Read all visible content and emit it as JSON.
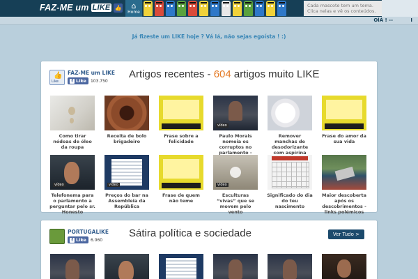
{
  "header": {
    "logo_text": "FAZ-ME um",
    "logo_like": "LIKE",
    "home_label": "Home",
    "tip_text": "Cada mascote tem um tema. Clica nelas e vê os conteúdos.",
    "greeting": "OlÁ ! -- ",
    "greeting_close": "I"
  },
  "mascots": [
    {
      "name": "mascot-1",
      "color": "#f0d23a"
    },
    {
      "name": "mascot-2",
      "color": "#d94b3a"
    },
    {
      "name": "mascot-3",
      "color": "#2e78c8"
    },
    {
      "name": "mascot-4",
      "color": "#5aa13d"
    },
    {
      "name": "mascot-5",
      "color": "#d94b3a"
    },
    {
      "name": "mascot-6",
      "color": "#f0d23a"
    },
    {
      "name": "mascot-7",
      "color": "#2e78c8"
    },
    {
      "name": "mascot-8",
      "color": "#e8e8e8"
    },
    {
      "name": "mascot-9",
      "color": "#f0d23a"
    },
    {
      "name": "mascot-10",
      "color": "#5aa13d"
    },
    {
      "name": "mascot-11",
      "color": "#2e78c8"
    },
    {
      "name": "mascot-12",
      "color": "#f0d23a"
    },
    {
      "name": "mascot-13",
      "color": "#2e78c8"
    }
  ],
  "banner": "Já fizeste um LIKE hoje ? Vá lá, não sejas egoísta ! :)",
  "recent": {
    "brand_name": "FAZ-ME um LIKE",
    "fb_label": "Like",
    "fb_count": "103.750",
    "title_prefix": "Artigos recentes - ",
    "count": "604",
    "title_suffix": " artigos muito LIKE",
    "articles": [
      {
        "caption": "Como tirar nódoas de óleo da roupa",
        "thumb": "t-shirt"
      },
      {
        "caption": "Receita de bolo brigadeiro",
        "thumb": "t-cake"
      },
      {
        "caption": "Frase sobre a felicidade",
        "thumb": "t-yellow"
      },
      {
        "caption": "Paulo Morais nomeia os corruptos no parlamento - vídeo",
        "thumb": "t-news"
      },
      {
        "caption": "Remover manchas de desodorizante com aspirina",
        "thumb": "t-pills"
      },
      {
        "caption": "Frase do amor da sua vida",
        "thumb": "t-yellow"
      },
      {
        "caption": "Telefonema para o parlamento a perguntar pelo sr. Honesto",
        "thumb": "t-man"
      },
      {
        "caption": "Preços do bar na Assembleia da República",
        "thumb": "t-table"
      },
      {
        "caption": "Frase de quem não teme",
        "thumb": "t-yellow"
      },
      {
        "caption": "Esculturas “vivas” que se movem pelo vento",
        "thumb": "t-play"
      },
      {
        "caption": "Significado do dia do teu nascimento",
        "thumb": "t-calendar"
      },
      {
        "caption": "Maior descoberta após os descobrimentos - links polémicos",
        "thumb": "t-flood"
      }
    ]
  },
  "satire": {
    "brand_name": "PORTUGALIKE",
    "fb_label": "Like",
    "fb_count": "6.060",
    "title": "Sátira política e sociedade",
    "see_all": "Ver Tudo >",
    "thumbs": [
      "t-news",
      "t-man",
      "t-table",
      "t-news",
      "t-news",
      "t-dark"
    ]
  },
  "video_tag": "vídeo"
}
